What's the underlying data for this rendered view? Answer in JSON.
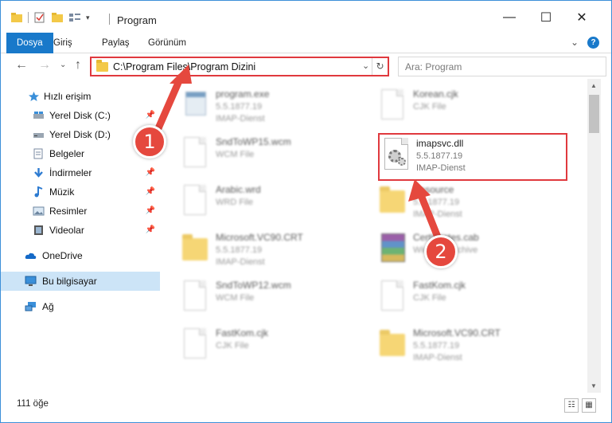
{
  "window": {
    "title": "Program",
    "minimize": "—",
    "maximize": "☐",
    "close": "✕"
  },
  "ribbon": {
    "tabs": [
      "Dosya",
      "Giriş",
      "Paylaş",
      "Görünüm"
    ],
    "collapse": "⌄",
    "help": "?"
  },
  "nav": {
    "back": "←",
    "forward": "→",
    "dropdown": "⌄",
    "up": "↑",
    "address": "C:\\Program Files\\Program Dizini",
    "address_dropdown": "⌄",
    "refresh": "↻",
    "search_placeholder": "Ara: Program"
  },
  "sidebar": {
    "items": [
      {
        "label": "Hızlı erişim",
        "icon": "star-icon",
        "pinned": false
      },
      {
        "label": "Yerel Disk (C:)",
        "icon": "drive-icon",
        "pinned": true
      },
      {
        "label": "Yerel Disk (D:)",
        "icon": "drive-icon",
        "pinned": false
      },
      {
        "label": "Belgeler",
        "icon": "documents-icon",
        "pinned": true
      },
      {
        "label": "İndirmeler",
        "icon": "download-icon",
        "pinned": true
      },
      {
        "label": "Müzik",
        "icon": "music-icon",
        "pinned": true
      },
      {
        "label": "Resimler",
        "icon": "pictures-icon",
        "pinned": true
      },
      {
        "label": "Videolar",
        "icon": "videos-icon",
        "pinned": true
      },
      {
        "label": "OneDrive",
        "icon": "cloud-icon",
        "pinned": false
      },
      {
        "label": "Bu bilgisayar",
        "icon": "computer-icon",
        "pinned": false
      },
      {
        "label": "Ağ",
        "icon": "network-icon",
        "pinned": false
      }
    ],
    "pin_glyph": "📌"
  },
  "files": [
    {
      "name": "program.exe",
      "line1": "5.5.1877.19",
      "line2": "IMAP-Dienst",
      "type": "exe"
    },
    {
      "name": "Korean.cjk",
      "line1": "CJK File",
      "line2": "",
      "type": "doc"
    },
    {
      "name": "SndToWP15.wcm",
      "line1": "WCM File",
      "line2": "",
      "type": "doc"
    },
    {
      "name": "imapsvc.dll",
      "line1": "5.5.1877.19",
      "line2": "IMAP-Dienst",
      "type": "dll"
    },
    {
      "name": "Arabic.wrd",
      "line1": "WRD File",
      "line2": "",
      "type": "doc"
    },
    {
      "name": "Resource",
      "line1": "5.5.1877.19",
      "line2": "IMAP-Dienst",
      "type": "folder"
    },
    {
      "name": "Microsoft.VC90.CRT",
      "line1": "5.5.1877.19",
      "line2": "IMAP-Dienst",
      "type": "folder"
    },
    {
      "name": "Certificates.cab",
      "line1": "WinRAR Archive",
      "line2": "",
      "type": "rar"
    },
    {
      "name": "SndToWP12.wcm",
      "line1": "WCM File",
      "line2": "",
      "type": "doc"
    },
    {
      "name": "FastKom.cjk",
      "line1": "CJK File",
      "line2": "",
      "type": "doc"
    },
    {
      "name": "FastKom.cjk",
      "line1": "CJK File",
      "line2": "",
      "type": "doc"
    },
    {
      "name": "Microsoft.VC90.CRT",
      "line1": "5.5.1877.19",
      "line2": "IMAP-Dienst",
      "type": "folder"
    }
  ],
  "status": {
    "count": "111 öğe",
    "details_view": "☷",
    "tiles_view": "▦"
  },
  "annotations": {
    "badge1": "1",
    "badge2": "2",
    "highlight_color": "#e0393e"
  },
  "colors": {
    "accent": "#1979ca",
    "selection": "#cce4f7",
    "annotation_red": "#e5483e"
  }
}
